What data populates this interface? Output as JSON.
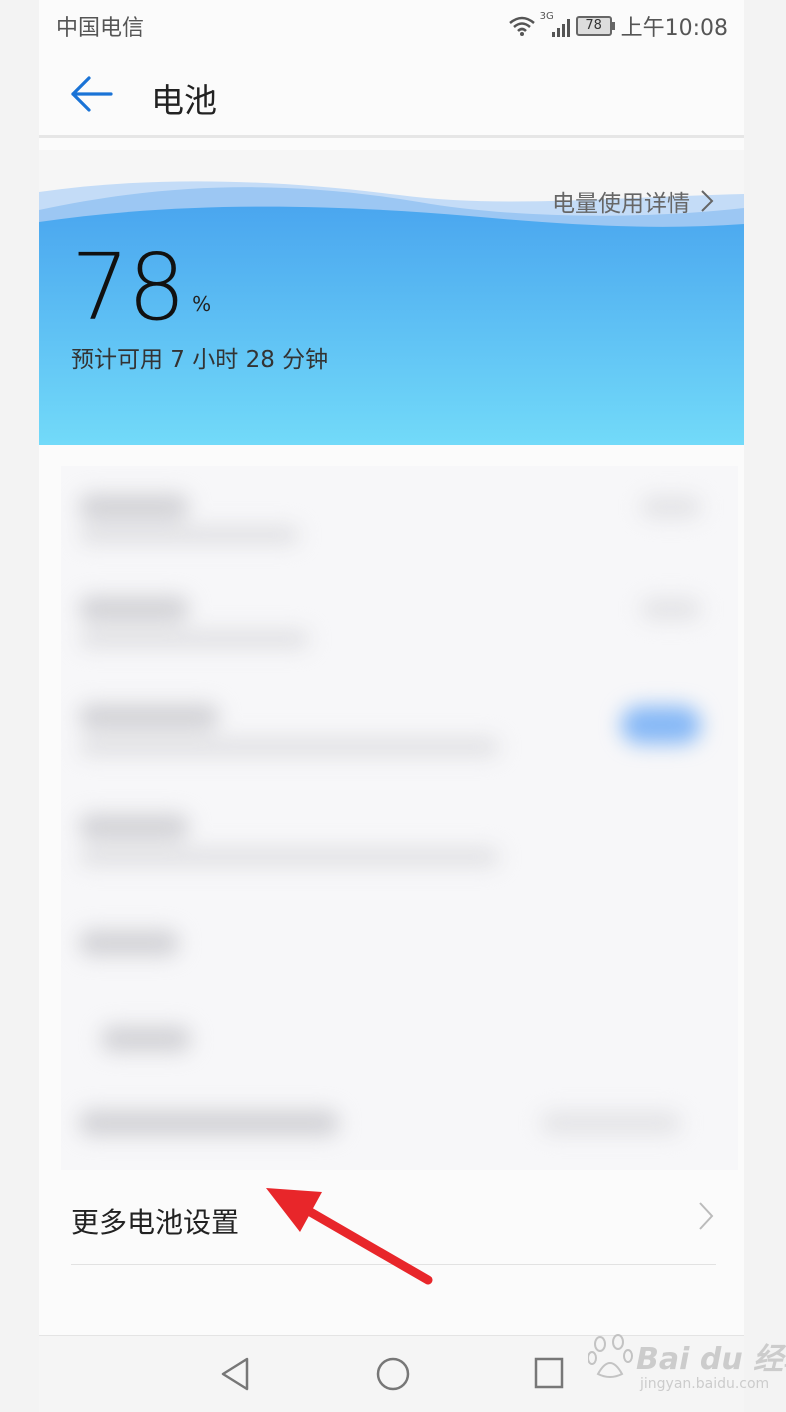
{
  "status_bar": {
    "carrier": "中国电信",
    "network": "3G",
    "battery_level": "78",
    "time": "上午10:08"
  },
  "action_bar": {
    "title": "电池"
  },
  "battery": {
    "usage_details_label": "电量使用详情",
    "percent": "78",
    "percent_unit": "%",
    "estimate": "预计可用 7 小时 28 分钟"
  },
  "settings": {
    "more_label": "更多电池设置"
  },
  "watermark": {
    "text": "Bai du 经验",
    "sub": "jingyan.baidu.com"
  },
  "colors": {
    "accent": "#1a73d6",
    "hero_top": "#4aa6ef",
    "hero_bottom": "#72daf9",
    "arrow": "#e8262a"
  }
}
